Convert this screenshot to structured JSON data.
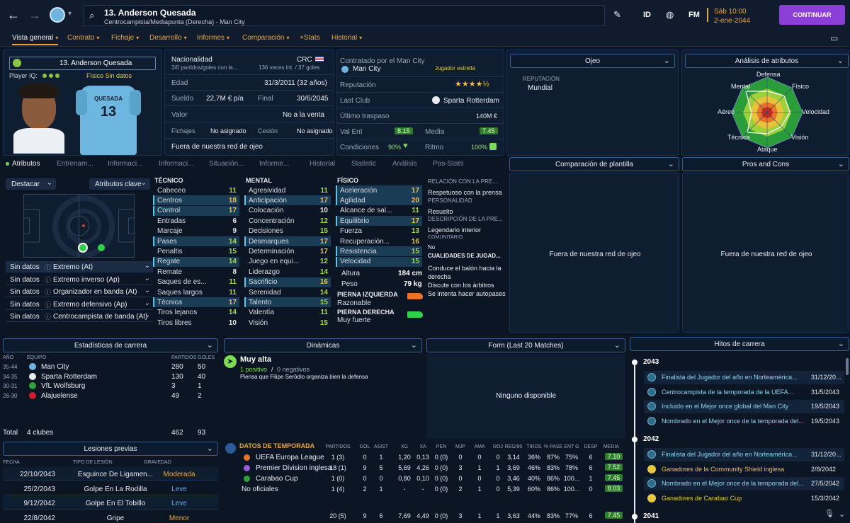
{
  "topbar": {
    "player_title": "13. Anderson Quesada",
    "player_subtitle": "Centrocampista/Mediapunta (Derecha) - Man City",
    "btn_id": "ID",
    "btn_fm": "FM",
    "date_line1": "Sáb 10:00",
    "date_line2": "2-ene-2044",
    "continue_label": "CONTINUAR"
  },
  "nav": [
    "Vista general",
    "Contrato",
    "Fichaje",
    "Desarrollo",
    "Informes",
    "Comparación",
    "+Stats",
    "Historial"
  ],
  "profile": {
    "name": "13. Anderson Quesada",
    "iq_label": "Player IQ:",
    "tags": "Físico  Sin datos",
    "shirt_name": "QUESADA",
    "shirt_number": "13"
  },
  "info": {
    "nationality_label": "Nacionalidad",
    "nationality_value": "CRC",
    "nationality_sub": "3/0 partidos/goles con la...",
    "nationality_caps": "136 veces int. / 37 goles",
    "edad_label": "Edad",
    "edad_value": "31/3/2011 (32 años)",
    "sueldo_label": "Sueldo",
    "sueldo_value": "22,7M € p/a",
    "final_label": "Final",
    "final_value": "30/6/2045",
    "valor_label": "Valor",
    "valor_value": "No a la venta",
    "fichajes_label": "Fichajes",
    "fichajes_value": "No asignado",
    "cesion_label": "Cesión",
    "cesion_value": "No asignado",
    "footer": "Fuera de nuestra red de ojeo"
  },
  "contract": {
    "contracted_by": "Contratado por el Man City",
    "club": "Man City",
    "star_label": "Jugador estrella",
    "rep_label": "Reputación",
    "stars": "★★★★½",
    "last_club_label": "Last Club",
    "last_club_value": "Sparta Rotterdam",
    "transfer_label": "Último traspaso",
    "transfer_value": "140M €",
    "valent_label": "Val Ent",
    "valent_value": "8.15",
    "media_label": "Media",
    "media_value": "7.45",
    "cond_label": "Condiciones",
    "cond_value": "90%",
    "ritmo_label": "Ritmo",
    "ritmo_value": "100%"
  },
  "ojeo": {
    "title": "Ojeo",
    "rep_label": "REPUTACIÓN",
    "rep_value": "Mundial"
  },
  "attr_analysis": {
    "title": "Análisis de atributos",
    "labels": [
      "Defensa",
      "Físico",
      "Velocidad",
      "Visión",
      "Ataque",
      "Técnica",
      "Aéreo",
      "Mental"
    ]
  },
  "tabs": [
    "Atributos",
    "Entrenam...",
    "Informaci...",
    "Informaci...",
    "Situación...",
    "Informe...",
    "Historial",
    "Statistic",
    "Análisis",
    "Pos-Stats"
  ],
  "pitch": {
    "highlight_label": "Destacar",
    "key_attr_label": "Atributos clave",
    "roles": [
      {
        "rating": "Sin datos",
        "role": "Extremo (At)"
      },
      {
        "rating": "Sin datos",
        "role": "Extremo inverso (Ap)"
      },
      {
        "rating": "Sin datos",
        "role": "Organizador en banda (At)"
      },
      {
        "rating": "Sin datos",
        "role": "Extremo defensivo (Ap)"
      },
      {
        "rating": "Sin datos",
        "role": "Centrocampista de banda (At)"
      }
    ]
  },
  "attributes": {
    "tecnico_title": "TÉCNICO",
    "mental_title": "MENTAL",
    "fisico_title": "FÍSICO",
    "tecnico": [
      {
        "n": "Cabeceo",
        "v": "11",
        "hl": false
      },
      {
        "n": "Centros",
        "v": "18",
        "hl": true
      },
      {
        "n": "Control",
        "v": "17",
        "hl": true
      },
      {
        "n": "Entradas",
        "v": "6",
        "hl": false
      },
      {
        "n": "Marcaje",
        "v": "9",
        "hl": false
      },
      {
        "n": "Pases",
        "v": "14",
        "hl": true
      },
      {
        "n": "Penaltis",
        "v": "15",
        "hl": false
      },
      {
        "n": "Regate",
        "v": "14",
        "hl": true
      },
      {
        "n": "Remate",
        "v": "8",
        "hl": false
      },
      {
        "n": "Saques de es...",
        "v": "11",
        "hl": false
      },
      {
        "n": "Saques largos",
        "v": "11",
        "hl": false
      },
      {
        "n": "Técnica",
        "v": "17",
        "hl": true
      },
      {
        "n": "Tiros lejanos",
        "v": "14",
        "hl": false
      },
      {
        "n": "Tiros libres",
        "v": "10",
        "hl": false
      }
    ],
    "mental": [
      {
        "n": "Agresividad",
        "v": "11",
        "hl": false
      },
      {
        "n": "Anticipación",
        "v": "17",
        "hl": true
      },
      {
        "n": "Colocación",
        "v": "10",
        "hl": false
      },
      {
        "n": "Concentración",
        "v": "12",
        "hl": false
      },
      {
        "n": "Decisiones",
        "v": "15",
        "hl": false
      },
      {
        "n": "Desmarques",
        "v": "17",
        "hl": true
      },
      {
        "n": "Determinación",
        "v": "17",
        "hl": false
      },
      {
        "n": "Juego en equi...",
        "v": "12",
        "hl": false
      },
      {
        "n": "Liderazgo",
        "v": "14",
        "hl": false
      },
      {
        "n": "Sacrificio",
        "v": "16",
        "hl": true
      },
      {
        "n": "Serenidad",
        "v": "14",
        "hl": false
      },
      {
        "n": "Talento",
        "v": "15",
        "hl": true
      },
      {
        "n": "Valentía",
        "v": "11",
        "hl": false
      },
      {
        "n": "Visión",
        "v": "15",
        "hl": false
      }
    ],
    "fisico": [
      {
        "n": "Aceleración",
        "v": "17",
        "hl": true
      },
      {
        "n": "Agilidad",
        "v": "20",
        "hl": true
      },
      {
        "n": "Alcance de sal...",
        "v": "11",
        "hl": false
      },
      {
        "n": "Equilibrio",
        "v": "17",
        "hl": true
      },
      {
        "n": "Fuerza",
        "v": "13",
        "hl": false
      },
      {
        "n": "Recuperación...",
        "v": "16",
        "hl": false
      },
      {
        "n": "Resistencia",
        "v": "15",
        "hl": true
      },
      {
        "n": "Velocidad",
        "v": "15",
        "hl": true
      }
    ],
    "altura_label": "Altura",
    "altura_value": "184 cm",
    "peso_label": "Peso",
    "peso_value": "79 kg",
    "pie_izq_label": "PIERNA IZQUIERDA",
    "pie_izq_value": "Razonable",
    "pie_der_label": "PIERNA DERECHA",
    "pie_der_value": "Muy fuerte"
  },
  "personality": {
    "rel_title": "RELACIÓN CON LA PRE...",
    "rel_value": "Respetuoso con la prensa",
    "pers_title": "PERSONALIDAD",
    "pers_value": "Resuelto",
    "desc_title": "DESCRIPCIÓN DE LA PRE...",
    "desc_value": "Legendario interior",
    "com_title": "COMUNITARIO",
    "com_value": "No",
    "qual_title": "CUALIDADES DE JUGAD...",
    "qualities": [
      "Conduce el balón hacia la derecha",
      "Discute con los árbitros",
      "Se intenta hacer autopases"
    ]
  },
  "squad_comparison": {
    "title": "Comparación de plantilla",
    "body": "Fuera de nuestra red de ojeo"
  },
  "pros_cons": {
    "title": "Pros and Cons",
    "body": "Fuera de nuestra red de ojeo"
  },
  "career": {
    "title": "Estadísticas de carrera",
    "headers": [
      "AÑO",
      "EQUIPO",
      "PARTIDOS",
      "GOLES"
    ],
    "rows": [
      {
        "year": "35-44",
        "team": "Man City",
        "apps": "280",
        "goals": "50"
      },
      {
        "year": "34-35",
        "team": "Sparta Rotterdam",
        "apps": "130",
        "goals": "40"
      },
      {
        "year": "30-31",
        "team": "VfL Wolfsburg",
        "apps": "3",
        "goals": "1"
      },
      {
        "year": "26-30",
        "team": "Alajuelense",
        "apps": "49",
        "goals": "2"
      }
    ],
    "total_label": "Total",
    "total_clubs": "4 clubes",
    "total_apps": "462",
    "total_goals": "93"
  },
  "dynamics": {
    "title": "Dinámicas",
    "level": "Muy alta",
    "positives": "1 positivo",
    "separator": "/",
    "negatives": "0 negativos",
    "note": "Piensa que Filipe Serôdio organiza bien la defensa"
  },
  "form": {
    "title": "Form (Last 20 Matches)",
    "empty": "Ninguno disponible"
  },
  "milestones": {
    "title": "Hitos de carrera",
    "groups": [
      {
        "year": "2043",
        "items": [
          {
            "text": "Finalista del Jugador del año en Norteamérica...",
            "date": "31/12/20...",
            "trophy": false
          },
          {
            "text": "Centrocampista de la temporada de la UEFA...",
            "date": "31/5/2043",
            "trophy": false
          },
          {
            "text": "Incluido en el Mejor once global del Man City",
            "date": "19/5/2043",
            "trophy": false
          },
          {
            "text": "Nombrado en el Mejor once de la temporada del...",
            "date": "19/5/2043",
            "trophy": false
          }
        ]
      },
      {
        "year": "2042",
        "items": [
          {
            "text": "Finalista del Jugador del año en Norteamérica...",
            "date": "31/12/20...",
            "trophy": false
          },
          {
            "text": "Ganadores de la Community Shield inglesa",
            "date": "2/8/2042",
            "trophy": true
          },
          {
            "text": "Nombrado en el Mejor once de la temporada del...",
            "date": "27/5/2042",
            "trophy": false
          },
          {
            "text": "Ganadores de Carabao Cup",
            "date": "15/3/2042",
            "trophy": true
          }
        ]
      }
    ],
    "next_year": "2041"
  },
  "injuries": {
    "title": "Lesiones previas",
    "headers": [
      "FECHA",
      "TIPO DE LESIÓN",
      "GRAVEDAD"
    ],
    "rows": [
      {
        "date": "22/10/2043",
        "type": "Esguince De Ligamen...",
        "sev": "Moderada",
        "sevColor": "#e8a640"
      },
      {
        "date": "25/2/2043",
        "type": "Golpe En La Rodilla",
        "sev": "Leve",
        "sevColor": "#6aa8e8"
      },
      {
        "date": "9/12/2042",
        "type": "Golpe En El Tobillo",
        "sev": "Leve",
        "sevColor": "#6aa8e8"
      },
      {
        "date": "22/8/2042",
        "type": "Gripe",
        "sev": "Menor",
        "sevColor": "#e8a640"
      }
    ]
  },
  "season": {
    "title": "DATOS DE TEMPORADA",
    "headers": [
      "PARTIDOS",
      "GOL",
      "ASIST",
      "XG",
      "XA",
      "PEN",
      "MJP",
      "AMA",
      "ROJ",
      "REG/90",
      "TIROS",
      "% PASE",
      "ENT G",
      "DESP",
      "MEDIA"
    ],
    "rows": [
      {
        "comp": "UEFA Europa League",
        "vals": [
          "1 (3)",
          "0",
          "1",
          "1,20",
          "0,13",
          "0 (0)",
          "0",
          "0",
          "0",
          "3,14",
          "36%",
          "87%",
          "75%",
          "6"
        ],
        "media": "7.10"
      },
      {
        "comp": "Premier Division inglesa",
        "vals": [
          "18 (1)",
          "9",
          "5",
          "5,69",
          "4,26",
          "0 (0)",
          "3",
          "1",
          "1",
          "3,69",
          "46%",
          "83%",
          "78%",
          "6"
        ],
        "media": "7.52"
      },
      {
        "comp": "Carabao Cup",
        "vals": [
          "1 (0)",
          "0",
          "0",
          "0,80",
          "0,10",
          "0 (0)",
          "0",
          "0",
          "0",
          "3,46",
          "40%",
          "86%",
          "100...",
          "1"
        ],
        "media": "7.45"
      },
      {
        "comp": "No oficiales",
        "vals": [
          "1 (4)",
          "2",
          "1",
          "-",
          "-",
          "0 (0)",
          "2",
          "1",
          "0",
          "5,39",
          "60%",
          "86%",
          "100...",
          "0"
        ],
        "media": "8.03"
      }
    ],
    "total": {
      "vals": [
        "20 (5)",
        "9",
        "6",
        "7,69",
        "4,49",
        "0 (0)",
        "3",
        "1",
        "1",
        "3,63",
        "44%",
        "83%",
        "77%",
        "6"
      ],
      "media": "7.45"
    }
  }
}
